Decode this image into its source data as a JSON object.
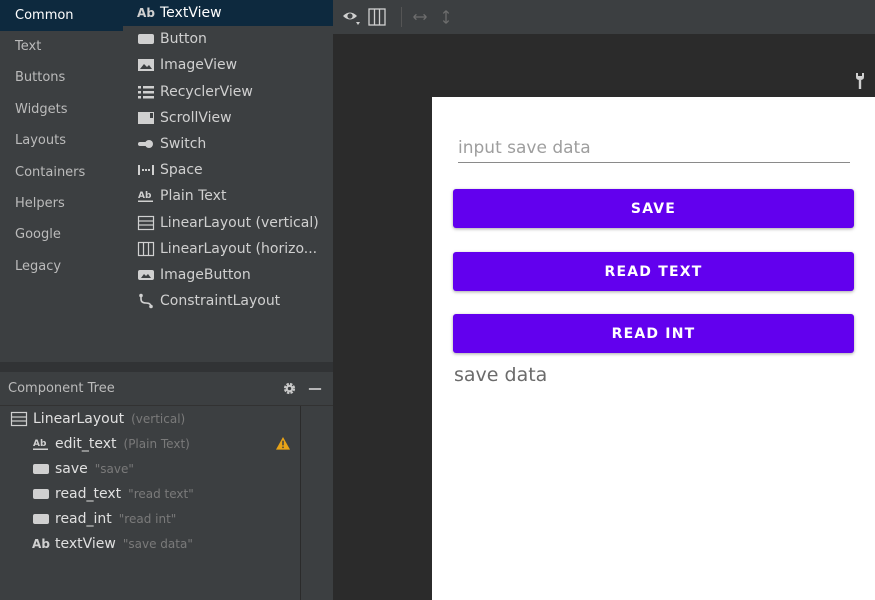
{
  "palette": {
    "categories": [
      "Common",
      "Text",
      "Buttons",
      "Widgets",
      "Layouts",
      "Containers",
      "Helpers",
      "Google",
      "Legacy"
    ],
    "selected_category": "Common",
    "widgets": [
      {
        "label": "TextView",
        "icon": "textview-icon"
      },
      {
        "label": "Button",
        "icon": "button-icon"
      },
      {
        "label": "ImageView",
        "icon": "imageview-icon"
      },
      {
        "label": "RecyclerView",
        "icon": "recyclerview-icon"
      },
      {
        "label": "ScrollView",
        "icon": "scrollview-icon"
      },
      {
        "label": "Switch",
        "icon": "switch-icon"
      },
      {
        "label": "Space",
        "icon": "space-icon"
      },
      {
        "label": "Plain Text",
        "icon": "plaintext-icon"
      },
      {
        "label": "LinearLayout (vertical)",
        "icon": "linearlayout-vertical-icon"
      },
      {
        "label": "LinearLayout (horizo...",
        "icon": "linearlayout-horizontal-icon"
      },
      {
        "label": "ImageButton",
        "icon": "imagebutton-icon"
      },
      {
        "label": "ConstraintLayout",
        "icon": "constraintlayout-icon"
      }
    ],
    "selected_widget": "TextView"
  },
  "tree": {
    "title": "Component Tree",
    "root": {
      "name": "LinearLayout",
      "desc": "(vertical)"
    },
    "children": [
      {
        "name": "edit_text",
        "desc": "(Plain Text)",
        "icon": "plaintext-icon",
        "warning": true
      },
      {
        "name": "save",
        "desc": "\"save\"",
        "icon": "button-icon",
        "warning": false
      },
      {
        "name": "read_text",
        "desc": "\"read text\"",
        "icon": "button-icon",
        "warning": false
      },
      {
        "name": "read_int",
        "desc": "\"read int\"",
        "icon": "button-icon",
        "warning": false
      },
      {
        "name": "textView",
        "desc": "\"save data\"",
        "icon": "textview-icon",
        "warning": false
      }
    ]
  },
  "toolbar": {
    "icons": [
      "eye-icon",
      "blueprint-icon",
      "horizontal-resize-icon",
      "vertical-resize-icon"
    ]
  },
  "preview": {
    "edit_hint": "input save data",
    "buttons": [
      "SAVE",
      "READ TEXT",
      "READ INT"
    ],
    "text_view": "save data"
  },
  "colors": {
    "accent": "#6200ee",
    "panel_bg": "#3c3f41",
    "selection_bg": "#0d293e",
    "warning": "#e8a317"
  }
}
